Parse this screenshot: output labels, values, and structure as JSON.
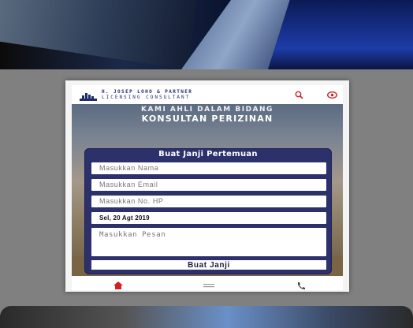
{
  "header": {
    "brand_name": "H. JOSEP LOHO & PARTNER",
    "brand_tagline": "LICENSING CONSULTANT",
    "search_icon": "search-icon",
    "eye_icon": "eye-icon",
    "accent": "#d02020"
  },
  "hero": {
    "line1": "KAMI AHLI DALAM BIDANG",
    "line2": "KONSULTAN PERIZINAN"
  },
  "form": {
    "title": "Buat Janji Pertemuan",
    "name_placeholder": "Masukkan Nama",
    "email_placeholder": "Masukkan Email",
    "phone_placeholder": "Masukkan No. HP",
    "date_value": "Sel, 20 Agt 2019",
    "message_placeholder": "Masukkan Pesan",
    "submit_label": "Buat Janji",
    "card_color": "#2c306b"
  },
  "nav": {
    "home_icon": "home-icon",
    "menu_icon": "menu-icon",
    "phone_icon": "phone-icon"
  }
}
